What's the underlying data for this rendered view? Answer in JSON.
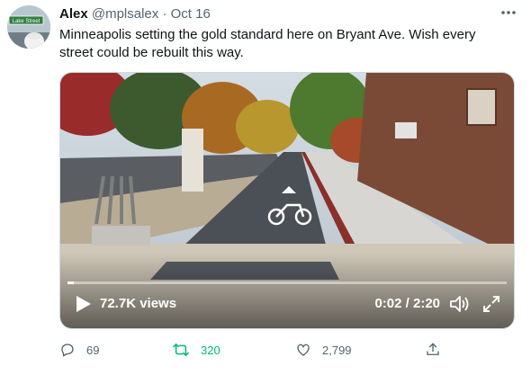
{
  "tweet": {
    "author_name": "Alex",
    "handle": "@mplsalex",
    "separator": "·",
    "date": "Oct 16",
    "text": "Minneapolis setting the gold standard here on Bryant Ave. Wish every street could be rebuilt this way.",
    "avatar_sign_text": "Lake Street"
  },
  "video": {
    "views": "72.7K views",
    "time": "0:02 / 2:20",
    "progress": 0.014
  },
  "actions": {
    "replies": "69",
    "retweets": "320",
    "likes": "2,799"
  },
  "colors": {
    "retweet_active": "#00ba7c",
    "secondary_text": "#536471"
  },
  "icons": [
    "more-icon",
    "play-icon",
    "volume-icon",
    "fullscreen-icon",
    "reply-icon",
    "retweet-icon",
    "like-icon",
    "share-icon"
  ]
}
